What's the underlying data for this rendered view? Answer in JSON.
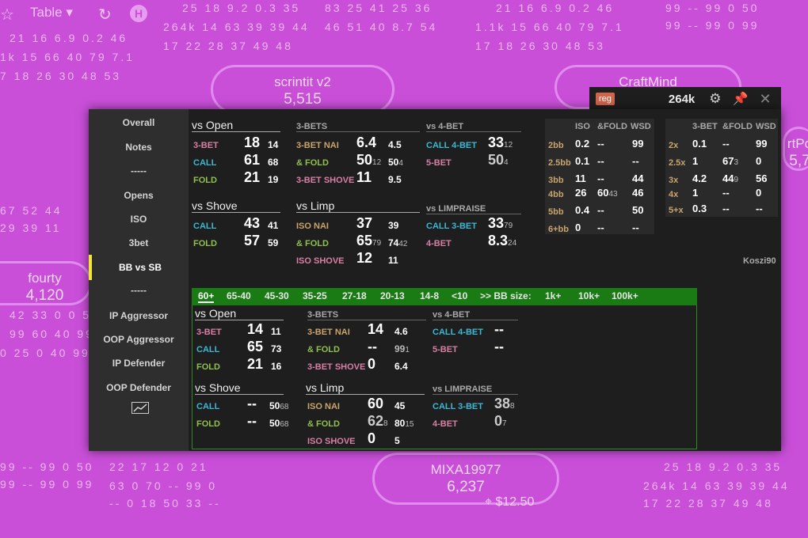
{
  "background": {
    "table_control": {
      "label": "Table"
    },
    "seats": [
      {
        "name": "scrintit v2",
        "stack": "5,515"
      },
      {
        "name": "CraftMind",
        "stack": ""
      },
      {
        "name": "MIXA19977",
        "stack": "6,237"
      },
      {
        "name": "fourty",
        "stack": "4,120"
      },
      {
        "name": "rtPo",
        "stack": "5,7"
      }
    ],
    "pot": "$12.50",
    "ghost_rows": [
      "25 18 9.2 0.3 35",
      "264k 14 63 39 39 44",
      "17 22 28 37 49 48",
      "83 25 41 25 36",
      "46 51 40 8.7 54",
      "21 16 6.9 0.2 46",
      "1.1k 15 66 40 79 7.1",
      "17 18 26 30 48 53",
      "99 -- 99 0 50",
      "99 -- 99 0 99",
      "21 16 6.9 0.2 46",
      "1k 15 66 40 79 7.1",
      "7 18 26 30 48 53",
      "67 52 44",
      "29 39 11",
      "42 33 0 0 5",
      "99 60 40 99",
      "0 25 0 40 99",
      "22 17 12 0 21",
      "63 0 70 -- 99 0",
      "-- 0 18 50 33 --",
      "99 -- 99 0 50",
      "99 -- 99 0 99",
      "25 18 9.2 0.3 35",
      "264k 14 63 39 39 44",
      "17 22 28 37 49 48"
    ]
  },
  "popup": {
    "badge": "reg",
    "hands": "264k",
    "author": "Koszi90",
    "sidebar": [
      "Overall",
      "Notes",
      "-----",
      "Opens",
      "ISO",
      "3bet",
      "BB vs SB",
      "-----",
      "IP Aggressor",
      "OOP Aggressor",
      "IP Defender",
      "OOP Defender"
    ],
    "active_item": "BB vs SB",
    "top": {
      "vs_open": {
        "title": "vs Open",
        "rows": [
          {
            "label": "3-BET",
            "v": "18",
            "s": "14"
          },
          {
            "label": "CALL",
            "v": "61",
            "s": "68"
          },
          {
            "label": "FOLD",
            "v": "21",
            "s": "19"
          }
        ]
      },
      "threebets": {
        "title": "3-BETS",
        "rows": [
          {
            "label": "3-BET NAI",
            "v": "6.4",
            "s": "4.5",
            "sub": ""
          },
          {
            "label": "& FOLD",
            "v": "50",
            "vsub": "12",
            "s": "50",
            "sub": "4"
          },
          {
            "label": "3-BET SHOVE",
            "v": "11",
            "s": "9.5",
            "sub": ""
          }
        ]
      },
      "vs4bet": {
        "title": "vs 4-BET",
        "rows": [
          {
            "label": "CALL 4-BET",
            "v": "33",
            "sub": "12"
          },
          {
            "label": "5-BET",
            "v": "50",
            "sub": "4"
          }
        ]
      },
      "vs_shove": {
        "title": "vs Shove",
        "rows": [
          {
            "label": "CALL",
            "v": "43",
            "s": "41"
          },
          {
            "label": "FOLD",
            "v": "57",
            "s": "59"
          }
        ]
      },
      "vs_limp": {
        "title": "vs Limp",
        "rows": [
          {
            "label": "ISO NAI",
            "v": "37",
            "vsub": "",
            "s": "39",
            "sub": ""
          },
          {
            "label": "& FOLD",
            "v": "65",
            "vsub": "79",
            "s": "74",
            "sub": "42"
          },
          {
            "label": "ISO SHOVE",
            "v": "12",
            "vsub": "",
            "s": "11",
            "sub": ""
          }
        ]
      },
      "vs_limpraise": {
        "title": "vs LIMPRAISE",
        "rows": [
          {
            "label": "CALL 3-BET",
            "v": "33",
            "sub": "79"
          },
          {
            "label": "4-BET",
            "v": "8.3",
            "sub": "24"
          }
        ]
      }
    },
    "size_table_1": {
      "headers": [
        "ISO",
        "&FOLD",
        "WSD"
      ],
      "rows": [
        {
          "label": "2bb",
          "c": [
            "0.2",
            "--",
            "99"
          ],
          "sub": ""
        },
        {
          "label": "2.5bb",
          "c": [
            "0.1",
            "--",
            "--"
          ],
          "sub": ""
        },
        {
          "label": "3bb",
          "c": [
            "11",
            "--",
            "44"
          ],
          "sub": ""
        },
        {
          "label": "4bb",
          "c": [
            "26",
            "60",
            "46"
          ],
          "sub": "43"
        },
        {
          "label": "5bb",
          "c": [
            "0.4",
            "--",
            "50"
          ],
          "sub": ""
        },
        {
          "label": "6+bb",
          "c": [
            "0",
            "--",
            "--"
          ],
          "sub": ""
        }
      ]
    },
    "size_table_2": {
      "headers": [
        "3-BET",
        "&FOLD",
        "WSD"
      ],
      "rows": [
        {
          "label": "2x",
          "c": [
            "0.1",
            "--",
            "99"
          ],
          "sub": ""
        },
        {
          "label": "2.5x",
          "c": [
            "1",
            "67",
            "0"
          ],
          "sub": "3"
        },
        {
          "label": "3x",
          "c": [
            "4.2",
            "44",
            "56"
          ],
          "sub": "9"
        },
        {
          "label": "4x",
          "c": [
            "1",
            "--",
            "0"
          ],
          "sub": ""
        },
        {
          "label": "5+x",
          "c": [
            "0.3",
            "--",
            "--"
          ],
          "sub": ""
        }
      ]
    },
    "tabs": [
      "60+",
      "65-40",
      "45-30",
      "35-25",
      "27-18",
      "20-13",
      "14-8",
      "<10",
      ">> BB size:",
      "1k+",
      "10k+",
      "100k+"
    ],
    "lower": {
      "vs_open": {
        "title": "vs Open",
        "rows": [
          {
            "label": "3-BET",
            "v": "14",
            "s": "11"
          },
          {
            "label": "CALL",
            "v": "65",
            "s": "73"
          },
          {
            "label": "FOLD",
            "v": "21",
            "s": "16"
          }
        ]
      },
      "threebets": {
        "title": "3-BETS",
        "rows": [
          {
            "label": "3-BET NAI",
            "v": "14",
            "s": "4.6",
            "sub": ""
          },
          {
            "label": "& FOLD",
            "v": "--",
            "s": "99",
            "sub": "1"
          },
          {
            "label": "3-BET SHOVE",
            "v": "0",
            "s": "6.4",
            "sub": ""
          }
        ]
      },
      "vs4bet": {
        "title": "vs 4-BET",
        "rows": [
          {
            "label": "CALL 4-BET",
            "v": "--"
          },
          {
            "label": "5-BET",
            "v": "--"
          }
        ]
      },
      "vs_shove": {
        "title": "vs Shove",
        "rows": [
          {
            "label": "CALL",
            "v": "--",
            "s": "50",
            "sub": "68"
          },
          {
            "label": "FOLD",
            "v": "--",
            "s": "50",
            "sub": "68"
          }
        ]
      },
      "vs_limp": {
        "title": "vs Limp",
        "rows": [
          {
            "label": "ISO NAI",
            "v": "60",
            "vsub": "",
            "s": "45",
            "sub": ""
          },
          {
            "label": "& FOLD",
            "v": "62",
            "vsub": "8",
            "s": "80",
            "sub": "15"
          },
          {
            "label": "ISO SHOVE",
            "v": "0",
            "vsub": "",
            "s": "5",
            "sub": ""
          }
        ]
      },
      "vs_limpraise": {
        "title": "vs LIMPRAISE",
        "rows": [
          {
            "label": "CALL 3-BET",
            "v": "38",
            "sub": "8"
          },
          {
            "label": "4-BET",
            "v": "0",
            "sub": "7"
          }
        ]
      }
    }
  }
}
